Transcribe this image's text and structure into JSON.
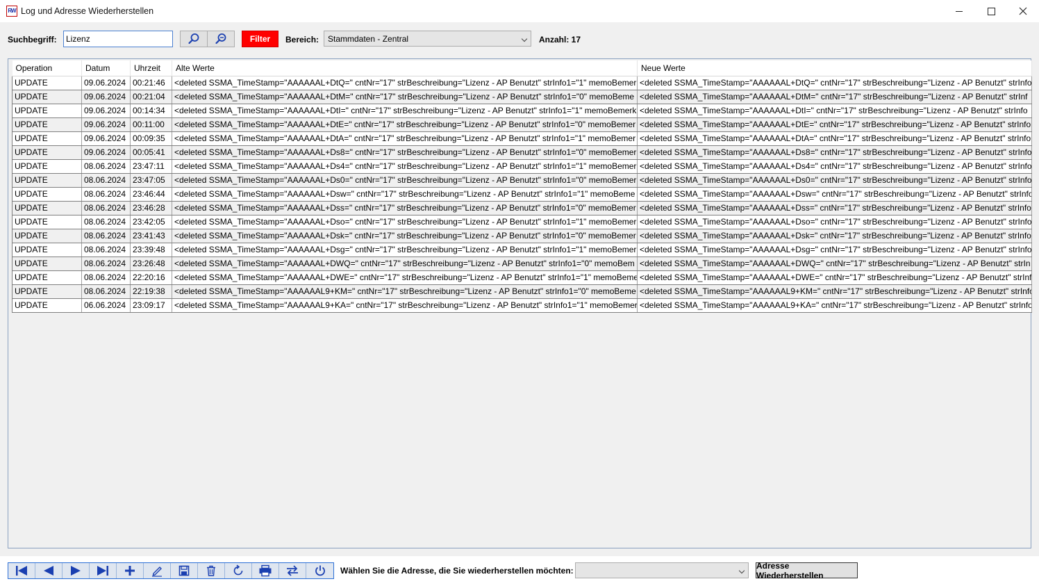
{
  "window": {
    "title": "Log und Adresse Wiederherstellen",
    "icon_text": "RW"
  },
  "toolbar": {
    "search_label": "Suchbegriff:",
    "search_value": "Lizenz",
    "filter_label": "Filter",
    "area_label": "Bereich:",
    "area_value": "Stammdaten - Zentral",
    "count_label": "Anzahl: 17"
  },
  "grid": {
    "columns": [
      "Operation",
      "Datum",
      "Uhrzeit",
      "Alte Werte",
      "Neue Werte"
    ],
    "rows": [
      {
        "op": "UPDATE",
        "date": "09.06.2024",
        "time": "00:21:46",
        "old": "<deleted SSMA_TimeStamp=\"AAAAAAL+DtQ=\" cntNr=\"17\" strBeschreibung=\"Lizenz - AP Benutzt\" strInfo1=\"1\" memoBemer",
        "new": "<deleted SSMA_TimeStamp=\"AAAAAAL+DtQ=\" cntNr=\"17\" strBeschreibung=\"Lizenz - AP Benutzt\" strInfo"
      },
      {
        "op": "UPDATE",
        "date": "09.06.2024",
        "time": "00:21:04",
        "old": "<deleted SSMA_TimeStamp=\"AAAAAAL+DtM=\" cntNr=\"17\" strBeschreibung=\"Lizenz - AP Benutzt\" strInfo1=\"0\" memoBeme",
        "new": "<deleted SSMA_TimeStamp=\"AAAAAAL+DtM=\" cntNr=\"17\" strBeschreibung=\"Lizenz - AP Benutzt\" strInf"
      },
      {
        "op": "UPDATE",
        "date": "09.06.2024",
        "time": "00:14:34",
        "old": "<deleted SSMA_TimeStamp=\"AAAAAAL+DtI=\" cntNr=\"17\" strBeschreibung=\"Lizenz - AP Benutzt\" strInfo1=\"1\" memoBemerk",
        "new": "<deleted SSMA_TimeStamp=\"AAAAAAL+DtI=\" cntNr=\"17\" strBeschreibung=\"Lizenz - AP Benutzt\" strInfo"
      },
      {
        "op": "UPDATE",
        "date": "09.06.2024",
        "time": "00:11:00",
        "old": "<deleted SSMA_TimeStamp=\"AAAAAAL+DtE=\" cntNr=\"17\" strBeschreibung=\"Lizenz - AP Benutzt\" strInfo1=\"0\" memoBemer",
        "new": "<deleted SSMA_TimeStamp=\"AAAAAAL+DtE=\" cntNr=\"17\" strBeschreibung=\"Lizenz - AP Benutzt\" strInfo"
      },
      {
        "op": "UPDATE",
        "date": "09.06.2024",
        "time": "00:09:35",
        "old": "<deleted SSMA_TimeStamp=\"AAAAAAL+DtA=\" cntNr=\"17\" strBeschreibung=\"Lizenz - AP Benutzt\" strInfo1=\"1\" memoBemer",
        "new": "<deleted SSMA_TimeStamp=\"AAAAAAL+DtA=\" cntNr=\"17\" strBeschreibung=\"Lizenz - AP Benutzt\" strInfo"
      },
      {
        "op": "UPDATE",
        "date": "09.06.2024",
        "time": "00:05:41",
        "old": "<deleted SSMA_TimeStamp=\"AAAAAAL+Ds8=\" cntNr=\"17\" strBeschreibung=\"Lizenz - AP Benutzt\" strInfo1=\"0\" memoBemer",
        "new": "<deleted SSMA_TimeStamp=\"AAAAAAL+Ds8=\" cntNr=\"17\" strBeschreibung=\"Lizenz - AP Benutzt\" strInfo"
      },
      {
        "op": "UPDATE",
        "date": "08.06.2024",
        "time": "23:47:11",
        "old": "<deleted SSMA_TimeStamp=\"AAAAAAL+Ds4=\" cntNr=\"17\" strBeschreibung=\"Lizenz - AP Benutzt\" strInfo1=\"1\" memoBemer",
        "new": "<deleted SSMA_TimeStamp=\"AAAAAAL+Ds4=\" cntNr=\"17\" strBeschreibung=\"Lizenz - AP Benutzt\" strInfo"
      },
      {
        "op": "UPDATE",
        "date": "08.06.2024",
        "time": "23:47:05",
        "old": "<deleted SSMA_TimeStamp=\"AAAAAAL+Ds0=\" cntNr=\"17\" strBeschreibung=\"Lizenz - AP Benutzt\" strInfo1=\"0\" memoBemer",
        "new": "<deleted SSMA_TimeStamp=\"AAAAAAL+Ds0=\" cntNr=\"17\" strBeschreibung=\"Lizenz - AP Benutzt\" strInfo"
      },
      {
        "op": "UPDATE",
        "date": "08.06.2024",
        "time": "23:46:44",
        "old": "<deleted SSMA_TimeStamp=\"AAAAAAL+Dsw=\" cntNr=\"17\" strBeschreibung=\"Lizenz - AP Benutzt\" strInfo1=\"1\" memoBeme",
        "new": "<deleted SSMA_TimeStamp=\"AAAAAAL+Dsw=\" cntNr=\"17\" strBeschreibung=\"Lizenz - AP Benutzt\" strInfo"
      },
      {
        "op": "UPDATE",
        "date": "08.06.2024",
        "time": "23:46:28",
        "old": "<deleted SSMA_TimeStamp=\"AAAAAAL+Dss=\" cntNr=\"17\" strBeschreibung=\"Lizenz - AP Benutzt\" strInfo1=\"0\" memoBemer",
        "new": "<deleted SSMA_TimeStamp=\"AAAAAAL+Dss=\" cntNr=\"17\" strBeschreibung=\"Lizenz - AP Benutzt\" strInfo"
      },
      {
        "op": "UPDATE",
        "date": "08.06.2024",
        "time": "23:42:05",
        "old": "<deleted SSMA_TimeStamp=\"AAAAAAL+Dso=\" cntNr=\"17\" strBeschreibung=\"Lizenz - AP Benutzt\" strInfo1=\"1\" memoBemer",
        "new": "<deleted SSMA_TimeStamp=\"AAAAAAL+Dso=\" cntNr=\"17\" strBeschreibung=\"Lizenz - AP Benutzt\" strInfo"
      },
      {
        "op": "UPDATE",
        "date": "08.06.2024",
        "time": "23:41:43",
        "old": "<deleted SSMA_TimeStamp=\"AAAAAAL+Dsk=\" cntNr=\"17\" strBeschreibung=\"Lizenz - AP Benutzt\" strInfo1=\"0\" memoBemer",
        "new": "<deleted SSMA_TimeStamp=\"AAAAAAL+Dsk=\" cntNr=\"17\" strBeschreibung=\"Lizenz - AP Benutzt\" strInfo"
      },
      {
        "op": "UPDATE",
        "date": "08.06.2024",
        "time": "23:39:48",
        "old": "<deleted SSMA_TimeStamp=\"AAAAAAL+Dsg=\" cntNr=\"17\" strBeschreibung=\"Lizenz - AP Benutzt\" strInfo1=\"1\" memoBemer",
        "new": "<deleted SSMA_TimeStamp=\"AAAAAAL+Dsg=\" cntNr=\"17\" strBeschreibung=\"Lizenz - AP Benutzt\" strInfo"
      },
      {
        "op": "UPDATE",
        "date": "08.06.2024",
        "time": "23:26:48",
        "old": "<deleted SSMA_TimeStamp=\"AAAAAAL+DWQ=\" cntNr=\"17\" strBeschreibung=\"Lizenz - AP Benutzt\" strInfo1=\"0\" memoBem",
        "new": "<deleted SSMA_TimeStamp=\"AAAAAAL+DWQ=\" cntNr=\"17\" strBeschreibung=\"Lizenz - AP Benutzt\" strIn"
      },
      {
        "op": "UPDATE",
        "date": "08.06.2024",
        "time": "22:20:16",
        "old": "<deleted SSMA_TimeStamp=\"AAAAAAL+DWE=\" cntNr=\"17\" strBeschreibung=\"Lizenz - AP Benutzt\" strInfo1=\"1\" memoBeme",
        "new": "<deleted SSMA_TimeStamp=\"AAAAAAL+DWE=\" cntNr=\"17\" strBeschreibung=\"Lizenz - AP Benutzt\" strInf"
      },
      {
        "op": "UPDATE",
        "date": "08.06.2024",
        "time": "22:19:38",
        "old": "<deleted SSMA_TimeStamp=\"AAAAAAL9+KM=\" cntNr=\"17\" strBeschreibung=\"Lizenz - AP Benutzt\" strInfo1=\"0\" memoBeme",
        "new": "<deleted SSMA_TimeStamp=\"AAAAAAL9+KM=\" cntNr=\"17\" strBeschreibung=\"Lizenz - AP Benutzt\" strInfo"
      },
      {
        "op": "UPDATE",
        "date": "06.06.2024",
        "time": "23:09:17",
        "old": "<deleted SSMA_TimeStamp=\"AAAAAAL9+KA=\" cntNr=\"17\" strBeschreibung=\"Lizenz - AP Benutzt\" strInfo1=\"1\" memoBemer",
        "new": "<deleted SSMA_TimeStamp=\"AAAAAAL9+KA=\" cntNr=\"17\" strBeschreibung=\"Lizenz - AP Benutzt\" strInfo"
      }
    ]
  },
  "bottom": {
    "nav_icons": [
      "first-record-icon",
      "previous-record-icon",
      "next-record-icon",
      "last-record-icon",
      "add-icon",
      "edit-icon",
      "save-icon",
      "delete-icon",
      "refresh-icon",
      "print-icon",
      "swap-icon",
      "power-icon"
    ],
    "restore_prompt": "Wählen Sie die Adresse, die Sie wiederherstellen möchten:",
    "restore_select_value": "",
    "restore_button": "Adresse Wiederherstellen"
  },
  "colors": {
    "filter_red": "#ff0000",
    "nav_blue": "#1a3fb0",
    "focus_blue": "#4a7fd0"
  }
}
